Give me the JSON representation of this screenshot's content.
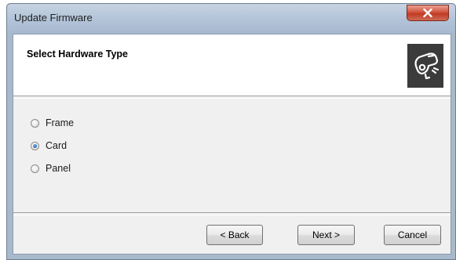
{
  "window": {
    "title": "Update Firmware"
  },
  "header": {
    "title": "Select Hardware Type",
    "icon": "whistle-icon"
  },
  "hardware_types": [
    {
      "label": "Frame",
      "selected": false
    },
    {
      "label": "Card",
      "selected": true
    },
    {
      "label": "Panel",
      "selected": false
    }
  ],
  "buttons": {
    "back": "< Back",
    "next": "Next >",
    "cancel": "Cancel"
  },
  "colors": {
    "titlebar": "#b2c3d8",
    "close_button": "#c03a22",
    "dialog_background": "#f0f0f0",
    "header_background": "#ffffff",
    "icon_background": "#3b3b3b"
  }
}
